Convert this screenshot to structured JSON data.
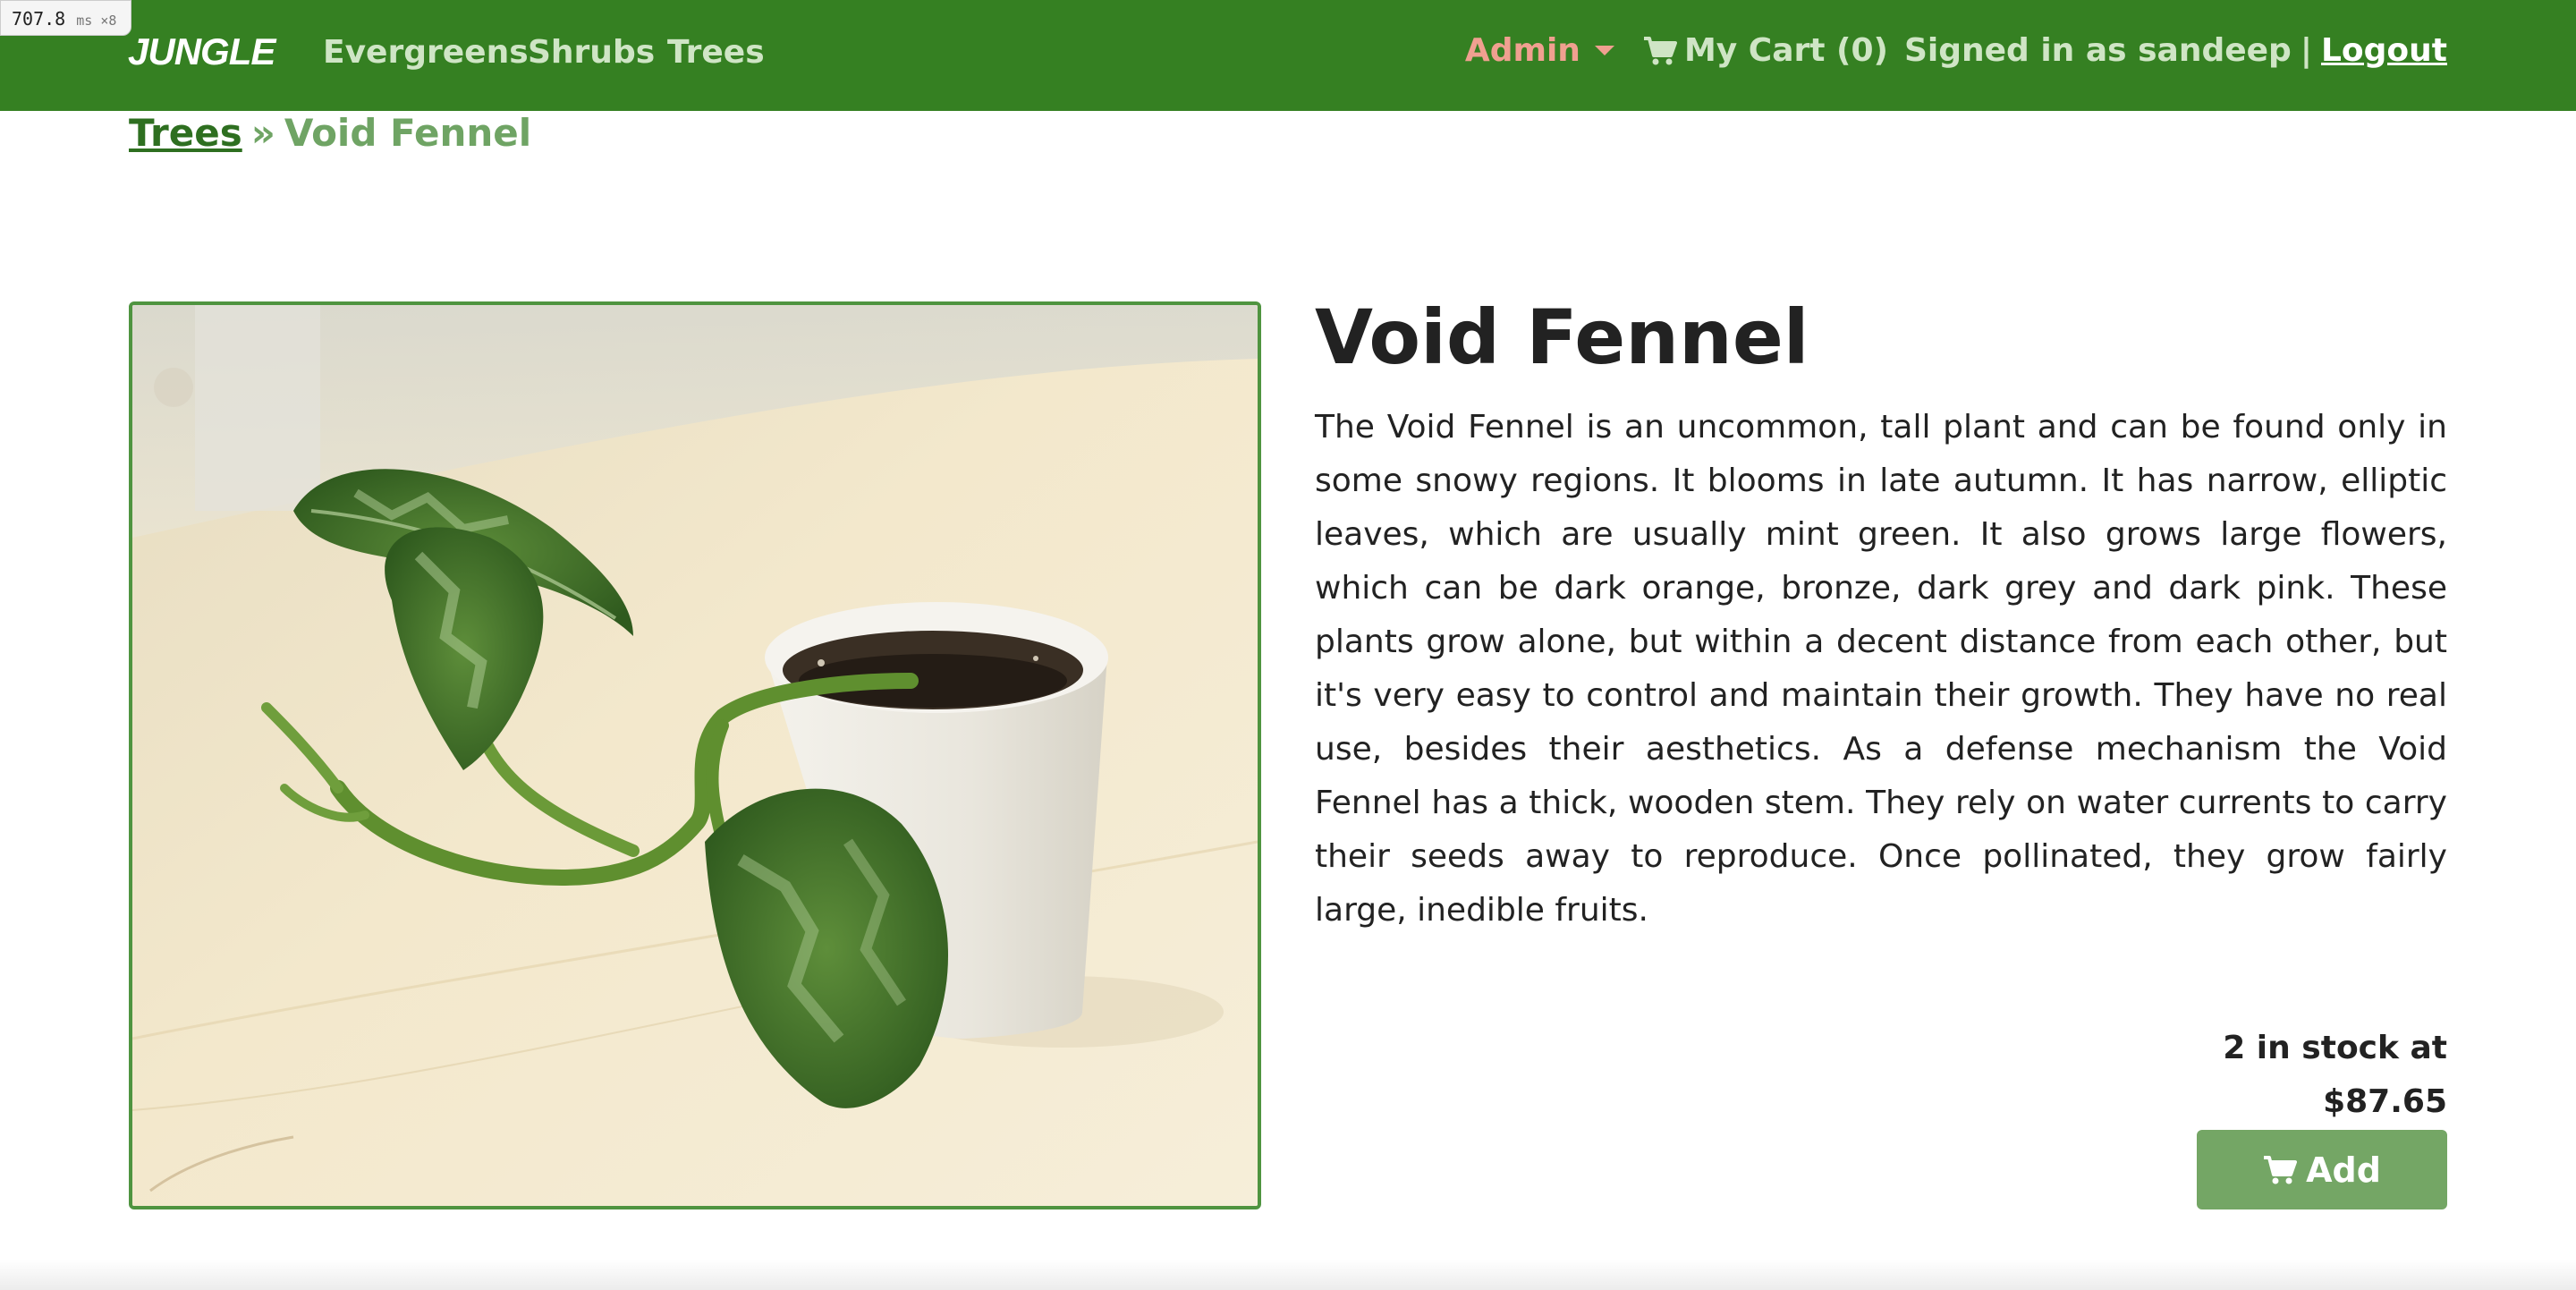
{
  "timing_badge": {
    "value": "707.8",
    "unit": "ms ×8"
  },
  "nav": {
    "brand": "JUNGLE",
    "links": [
      "Evergreens",
      "Shrubs",
      "Trees"
    ],
    "admin_label": "Admin",
    "cart_label": "My Cart (0)",
    "signed_in_text": "Signed in as sandeep",
    "separator": "|",
    "logout_label": "Logout",
    "colors": {
      "bar": "#358022",
      "admin": "#f0a090",
      "link": "#cfe5c5"
    }
  },
  "breadcrumb": {
    "category": "Trees",
    "separator": "»",
    "current": "Void Fennel"
  },
  "product": {
    "name": "Void Fennel",
    "description": "The Void Fennel is an uncommon, tall plant and can be found only in some snowy regions. It blooms in late autumn. It has narrow, elliptic leaves, which are usually mint green. It also grows large flowers, which can be dark orange, bronze, dark grey and dark pink. These plants grow alone, but within a decent distance from each other, but it's very easy to control and maintain their growth. They have no real use, besides their aesthetics. As a defense mechanism the Void Fennel has a thick, wooden stem. They rely on water currents to carry their seeds away to reproduce. Once pollinated, they grow fairly large, inedible fruits.",
    "stock_line": "2 in stock at",
    "price": "$87.65",
    "add_label": "Add",
    "image_subject": "pothos-plant-in-white-pot"
  }
}
